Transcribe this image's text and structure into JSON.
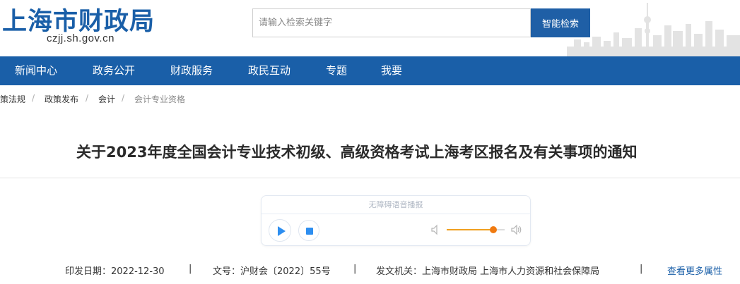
{
  "header": {
    "logo_title": "上海市财政局",
    "logo_url": "czjj.sh.gov.cn",
    "search_placeholder": "请输入检索关键字",
    "search_button": "智能检索"
  },
  "nav": {
    "items": [
      "新闻中心",
      "政务公开",
      "财政服务",
      "政民互动",
      "专题",
      "我要"
    ]
  },
  "breadcrumb": {
    "items": [
      "策法规",
      "政策发布",
      "会计",
      "会计专业资格"
    ],
    "separator": "/"
  },
  "article": {
    "title": "关于2023年度全国会计专业技术初级、高级资格考试上海考区报名及有关事项的通知"
  },
  "player": {
    "title": "无障碍语音播报",
    "volume_level": 0.8,
    "accent_color": "#f07a10"
  },
  "meta": {
    "date_label": "印发日期：2022-12-30",
    "doc_no": "文号：沪财会〔2022〕55号",
    "issuer": "发文机关：上海市财政局 上海市人力资源和社会保障局",
    "separator": "|",
    "more_link": "查看更多属性"
  },
  "colors": {
    "brand": "#1a5fa8",
    "nav_bg": "#1a5fa8"
  }
}
